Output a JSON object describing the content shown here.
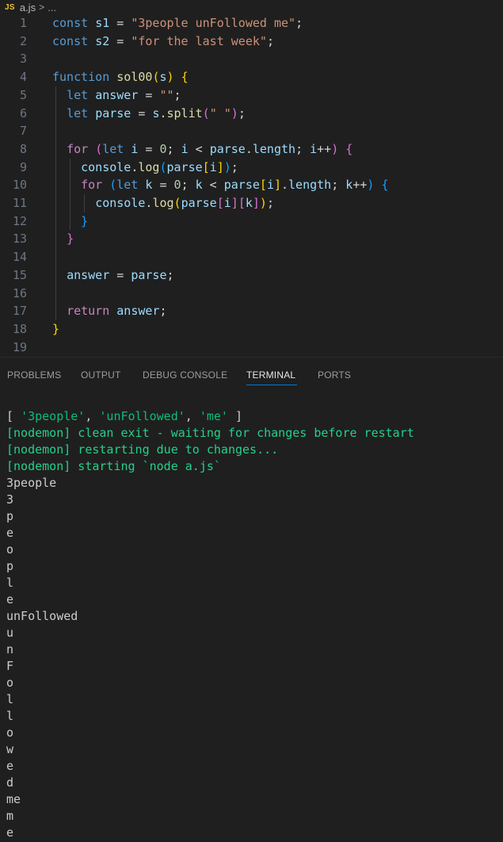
{
  "breadcrumb": {
    "badge": "JS",
    "file": "a.js",
    "separator": ">",
    "more": "..."
  },
  "editor": {
    "line_numbers": [
      "1",
      "2",
      "3",
      "4",
      "5",
      "6",
      "7",
      "8",
      "9",
      "10",
      "11",
      "12",
      "13",
      "14",
      "15",
      "16",
      "17",
      "18",
      "19"
    ],
    "lines": [
      [
        [
          "kw",
          "const"
        ],
        [
          "punc",
          " "
        ],
        [
          "var",
          "s1"
        ],
        [
          "punc",
          " = "
        ],
        [
          "str",
          "\"3people unFollowed me\""
        ],
        [
          "punc",
          ";"
        ]
      ],
      [
        [
          "kw",
          "const"
        ],
        [
          "punc",
          " "
        ],
        [
          "var",
          "s2"
        ],
        [
          "punc",
          " = "
        ],
        [
          "str",
          "\"for the last week\""
        ],
        [
          "punc",
          ";"
        ]
      ],
      [],
      [
        [
          "kw",
          "function"
        ],
        [
          "punc",
          " "
        ],
        [
          "fn",
          "sol00"
        ],
        [
          "br1",
          "("
        ],
        [
          "var",
          "s"
        ],
        [
          "br1",
          ")"
        ],
        [
          "punc",
          " "
        ],
        [
          "br1",
          "{"
        ]
      ],
      [
        [
          "punc",
          "  "
        ],
        [
          "kw",
          "let"
        ],
        [
          "punc",
          " "
        ],
        [
          "var",
          "answer"
        ],
        [
          "punc",
          " = "
        ],
        [
          "str",
          "\"\""
        ],
        [
          "punc",
          ";"
        ]
      ],
      [
        [
          "punc",
          "  "
        ],
        [
          "kw",
          "let"
        ],
        [
          "punc",
          " "
        ],
        [
          "var",
          "parse"
        ],
        [
          "punc",
          " = "
        ],
        [
          "var",
          "s"
        ],
        [
          "punc",
          "."
        ],
        [
          "fn",
          "split"
        ],
        [
          "br2",
          "("
        ],
        [
          "str",
          "\" \""
        ],
        [
          "br2",
          ")"
        ],
        [
          "punc",
          ";"
        ]
      ],
      [],
      [
        [
          "punc",
          "  "
        ],
        [
          "ctl",
          "for"
        ],
        [
          "punc",
          " "
        ],
        [
          "br2",
          "("
        ],
        [
          "kw",
          "let"
        ],
        [
          "punc",
          " "
        ],
        [
          "var",
          "i"
        ],
        [
          "punc",
          " = "
        ],
        [
          "num",
          "0"
        ],
        [
          "punc",
          "; "
        ],
        [
          "var",
          "i"
        ],
        [
          "punc",
          " < "
        ],
        [
          "var",
          "parse"
        ],
        [
          "punc",
          "."
        ],
        [
          "var",
          "length"
        ],
        [
          "punc",
          "; "
        ],
        [
          "var",
          "i"
        ],
        [
          "punc",
          "++"
        ],
        [
          "br2",
          ")"
        ],
        [
          "punc",
          " "
        ],
        [
          "br2",
          "{"
        ]
      ],
      [
        [
          "punc",
          "    "
        ],
        [
          "var",
          "console"
        ],
        [
          "punc",
          "."
        ],
        [
          "fn",
          "log"
        ],
        [
          "br3",
          "("
        ],
        [
          "var",
          "parse"
        ],
        [
          "br1",
          "["
        ],
        [
          "var",
          "i"
        ],
        [
          "br1",
          "]"
        ],
        [
          "br3",
          ")"
        ],
        [
          "punc",
          ";"
        ]
      ],
      [
        [
          "punc",
          "    "
        ],
        [
          "ctl",
          "for"
        ],
        [
          "punc",
          " "
        ],
        [
          "br3",
          "("
        ],
        [
          "kw",
          "let"
        ],
        [
          "punc",
          " "
        ],
        [
          "var",
          "k"
        ],
        [
          "punc",
          " = "
        ],
        [
          "num",
          "0"
        ],
        [
          "punc",
          "; "
        ],
        [
          "var",
          "k"
        ],
        [
          "punc",
          " < "
        ],
        [
          "var",
          "parse"
        ],
        [
          "br1",
          "["
        ],
        [
          "var",
          "i"
        ],
        [
          "br1",
          "]"
        ],
        [
          "punc",
          "."
        ],
        [
          "var",
          "length"
        ],
        [
          "punc",
          "; "
        ],
        [
          "var",
          "k"
        ],
        [
          "punc",
          "++"
        ],
        [
          "br3",
          ")"
        ],
        [
          "punc",
          " "
        ],
        [
          "br3",
          "{"
        ]
      ],
      [
        [
          "punc",
          "      "
        ],
        [
          "var",
          "console"
        ],
        [
          "punc",
          "."
        ],
        [
          "fn",
          "log"
        ],
        [
          "br1",
          "("
        ],
        [
          "var",
          "parse"
        ],
        [
          "br2",
          "["
        ],
        [
          "var",
          "i"
        ],
        [
          "br2",
          "]"
        ],
        [
          "br2",
          "["
        ],
        [
          "var",
          "k"
        ],
        [
          "br2",
          "]"
        ],
        [
          "br1",
          ")"
        ],
        [
          "punc",
          ";"
        ]
      ],
      [
        [
          "punc",
          "    "
        ],
        [
          "br3",
          "}"
        ]
      ],
      [
        [
          "punc",
          "  "
        ],
        [
          "br2",
          "}"
        ]
      ],
      [],
      [
        [
          "punc",
          "  "
        ],
        [
          "var",
          "answer"
        ],
        [
          "punc",
          " = "
        ],
        [
          "var",
          "parse"
        ],
        [
          "punc",
          ";"
        ]
      ],
      [],
      [
        [
          "punc",
          "  "
        ],
        [
          "ctl",
          "return"
        ],
        [
          "punc",
          " "
        ],
        [
          "var",
          "answer"
        ],
        [
          "punc",
          ";"
        ]
      ],
      [
        [
          "br1",
          "}"
        ]
      ],
      []
    ]
  },
  "panel": {
    "tabs": [
      {
        "label": "PROBLEMS",
        "active": false
      },
      {
        "label": "OUTPUT",
        "active": false
      },
      {
        "label": "DEBUG CONSOLE",
        "active": false
      },
      {
        "label": "TERMINAL",
        "active": true
      },
      {
        "label": "PORTS",
        "active": false
      }
    ]
  },
  "terminal": {
    "lines": [
      [
        [
          "plain",
          "[ "
        ],
        [
          "str",
          "'3people'"
        ],
        [
          "plain",
          ", "
        ],
        [
          "str",
          "'unFollowed'"
        ],
        [
          "plain",
          ", "
        ],
        [
          "str",
          "'me'"
        ],
        [
          "plain",
          " ]"
        ]
      ],
      [
        [
          "green",
          "[nodemon] clean exit - waiting for changes before restart"
        ]
      ],
      [
        [
          "green",
          "[nodemon] restarting due to changes..."
        ]
      ],
      [
        [
          "green",
          "[nodemon] starting `node a.js`"
        ]
      ],
      [
        [
          "plain",
          "3people"
        ]
      ],
      [
        [
          "plain",
          "3"
        ]
      ],
      [
        [
          "plain",
          "p"
        ]
      ],
      [
        [
          "plain",
          "e"
        ]
      ],
      [
        [
          "plain",
          "o"
        ]
      ],
      [
        [
          "plain",
          "p"
        ]
      ],
      [
        [
          "plain",
          "l"
        ]
      ],
      [
        [
          "plain",
          "e"
        ]
      ],
      [
        [
          "plain",
          "unFollowed"
        ]
      ],
      [
        [
          "plain",
          "u"
        ]
      ],
      [
        [
          "plain",
          "n"
        ]
      ],
      [
        [
          "plain",
          "F"
        ]
      ],
      [
        [
          "plain",
          "o"
        ]
      ],
      [
        [
          "plain",
          "l"
        ]
      ],
      [
        [
          "plain",
          "l"
        ]
      ],
      [
        [
          "plain",
          "o"
        ]
      ],
      [
        [
          "plain",
          "w"
        ]
      ],
      [
        [
          "plain",
          "e"
        ]
      ],
      [
        [
          "plain",
          "d"
        ]
      ],
      [
        [
          "plain",
          "me"
        ]
      ],
      [
        [
          "plain",
          "m"
        ]
      ],
      [
        [
          "plain",
          "e"
        ]
      ]
    ]
  },
  "colors": {
    "background": "#1f1f1f",
    "active_tab_underline": "#0078d4",
    "terminal_green": "#23d18b",
    "terminal_string": "#0dbc79"
  }
}
